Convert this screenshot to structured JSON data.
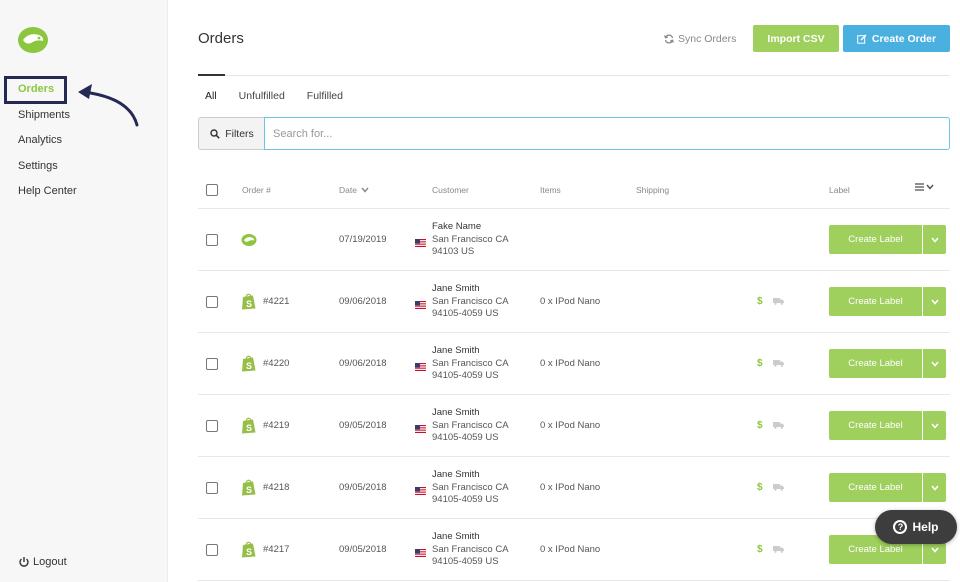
{
  "sidebar": {
    "items": [
      {
        "label": "Orders",
        "active": true
      },
      {
        "label": "Shipments"
      },
      {
        "label": "Analytics"
      },
      {
        "label": "Settings"
      },
      {
        "label": "Help Center"
      }
    ],
    "logout_label": "Logout"
  },
  "header": {
    "title": "Orders",
    "sync_label": "Sync Orders",
    "import_label": "Import CSV",
    "create_label": "Create Order"
  },
  "tabs": [
    "All",
    "Unfulfilled",
    "Fulfilled"
  ],
  "filters_label": "Filters",
  "search": {
    "placeholder": "Search for...",
    "value": ""
  },
  "table": {
    "headers": {
      "order": "Order #",
      "date": "Date",
      "customer": "Customer",
      "items": "Items",
      "shipping": "Shipping",
      "label": "Label"
    },
    "rows": [
      {
        "source": "app-logo-icon",
        "order": "",
        "date": "07/19/2019",
        "name": "Fake Name",
        "city": "San Francisco CA",
        "zip": "94103 US",
        "items": "",
        "shipping_icons": false
      },
      {
        "source": "shopify-icon",
        "order": "#4221",
        "date": "09/06/2018",
        "name": "Jane Smith",
        "city": "San Francisco CA",
        "zip": "94105-4059 US",
        "items": "0 x IPod Nano",
        "shipping_icons": true
      },
      {
        "source": "shopify-icon",
        "order": "#4220",
        "date": "09/06/2018",
        "name": "Jane Smith",
        "city": "San Francisco CA",
        "zip": "94105-4059 US",
        "items": "0 x IPod Nano",
        "shipping_icons": true
      },
      {
        "source": "shopify-icon",
        "order": "#4219",
        "date": "09/05/2018",
        "name": "Jane Smith",
        "city": "San Francisco CA",
        "zip": "94105-4059 US",
        "items": "0 x IPod Nano",
        "shipping_icons": true
      },
      {
        "source": "shopify-icon",
        "order": "#4218",
        "date": "09/05/2018",
        "name": "Jane Smith",
        "city": "San Francisco CA",
        "zip": "94105-4059 US",
        "items": "0 x IPod Nano",
        "shipping_icons": true
      },
      {
        "source": "shopify-icon",
        "order": "#4217",
        "date": "09/05/2018",
        "name": "Jane Smith",
        "city": "San Francisco CA",
        "zip": "94105-4059 US",
        "items": "0 x IPod Nano",
        "shipping_icons": true
      }
    ],
    "row_button_label": "Create Label",
    "dollar_symbol": "$"
  },
  "help_label": "Help",
  "colors": {
    "brand_green": "#8cc63f",
    "button_green": "#9fcf5c",
    "button_blue": "#4ab0e0",
    "highlight": "#252a54"
  }
}
